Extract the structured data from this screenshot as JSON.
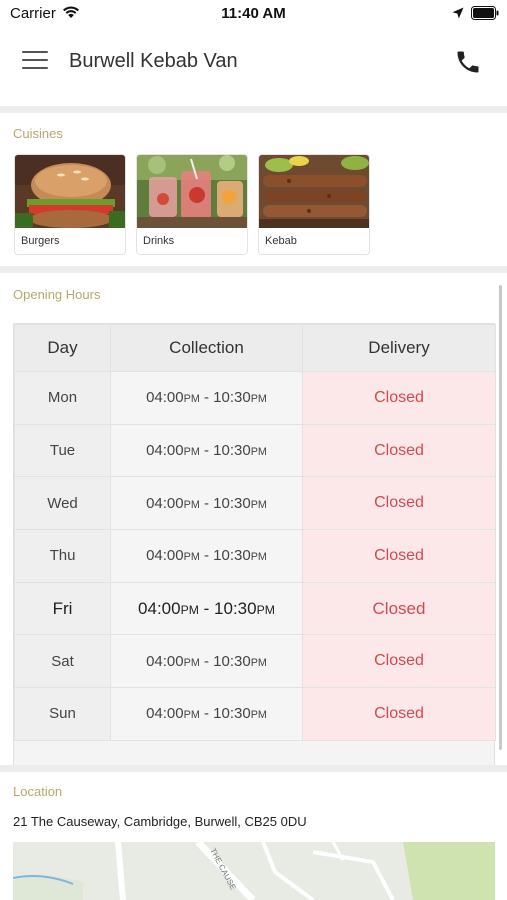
{
  "status_bar": {
    "carrier": "Carrier",
    "time": "11:40 AM"
  },
  "nav": {
    "title": "Burwell Kebab Van",
    "menu_icon": "hamburger-menu-icon",
    "call_icon": "phone-icon"
  },
  "cuisines": {
    "heading": "Cuisines",
    "items": [
      {
        "label": "Burgers"
      },
      {
        "label": "Drinks"
      },
      {
        "label": "Kebab"
      }
    ]
  },
  "opening_hours": {
    "heading": "Opening Hours",
    "columns": [
      "Day",
      "Collection",
      "Delivery"
    ],
    "rows": [
      {
        "day": "Mon",
        "open": "04:00",
        "open_ampm": "PM",
        "sep": " - ",
        "close": "10:30",
        "close_ampm": "PM",
        "delivery": "Closed"
      },
      {
        "day": "Tue",
        "open": "04:00",
        "open_ampm": "PM",
        "sep": " - ",
        "close": "10:30",
        "close_ampm": "PM",
        "delivery": "Closed"
      },
      {
        "day": "Wed",
        "open": "04:00",
        "open_ampm": "PM",
        "sep": " - ",
        "close": "10:30",
        "close_ampm": "PM",
        "delivery": "Closed"
      },
      {
        "day": "Thu",
        "open": "04:00",
        "open_ampm": "PM",
        "sep": " - ",
        "close": "10:30",
        "close_ampm": "PM",
        "delivery": "Closed"
      },
      {
        "day": "Fri",
        "open": "04:00",
        "open_ampm": "PM",
        "sep": " - ",
        "close": "10:30",
        "close_ampm": "PM",
        "delivery": "Closed"
      },
      {
        "day": "Sat",
        "open": "04:00",
        "open_ampm": "PM",
        "sep": " - ",
        "close": "10:30",
        "close_ampm": "PM",
        "delivery": "Closed"
      },
      {
        "day": "Sun",
        "open": "04:00",
        "open_ampm": "PM",
        "sep": " - ",
        "close": "10:30",
        "close_ampm": "PM",
        "delivery": "Closed"
      }
    ],
    "highlighted_day": "Fri"
  },
  "location": {
    "heading": "Location",
    "address": "21 The Causeway, Cambridge, Burwell, CB25 0DU",
    "map_street_label": "THE CAUSE"
  },
  "colors": {
    "section_heading": "#b9a770",
    "closed_text": "#d24a4f",
    "closed_bg": "#fce8e9"
  }
}
